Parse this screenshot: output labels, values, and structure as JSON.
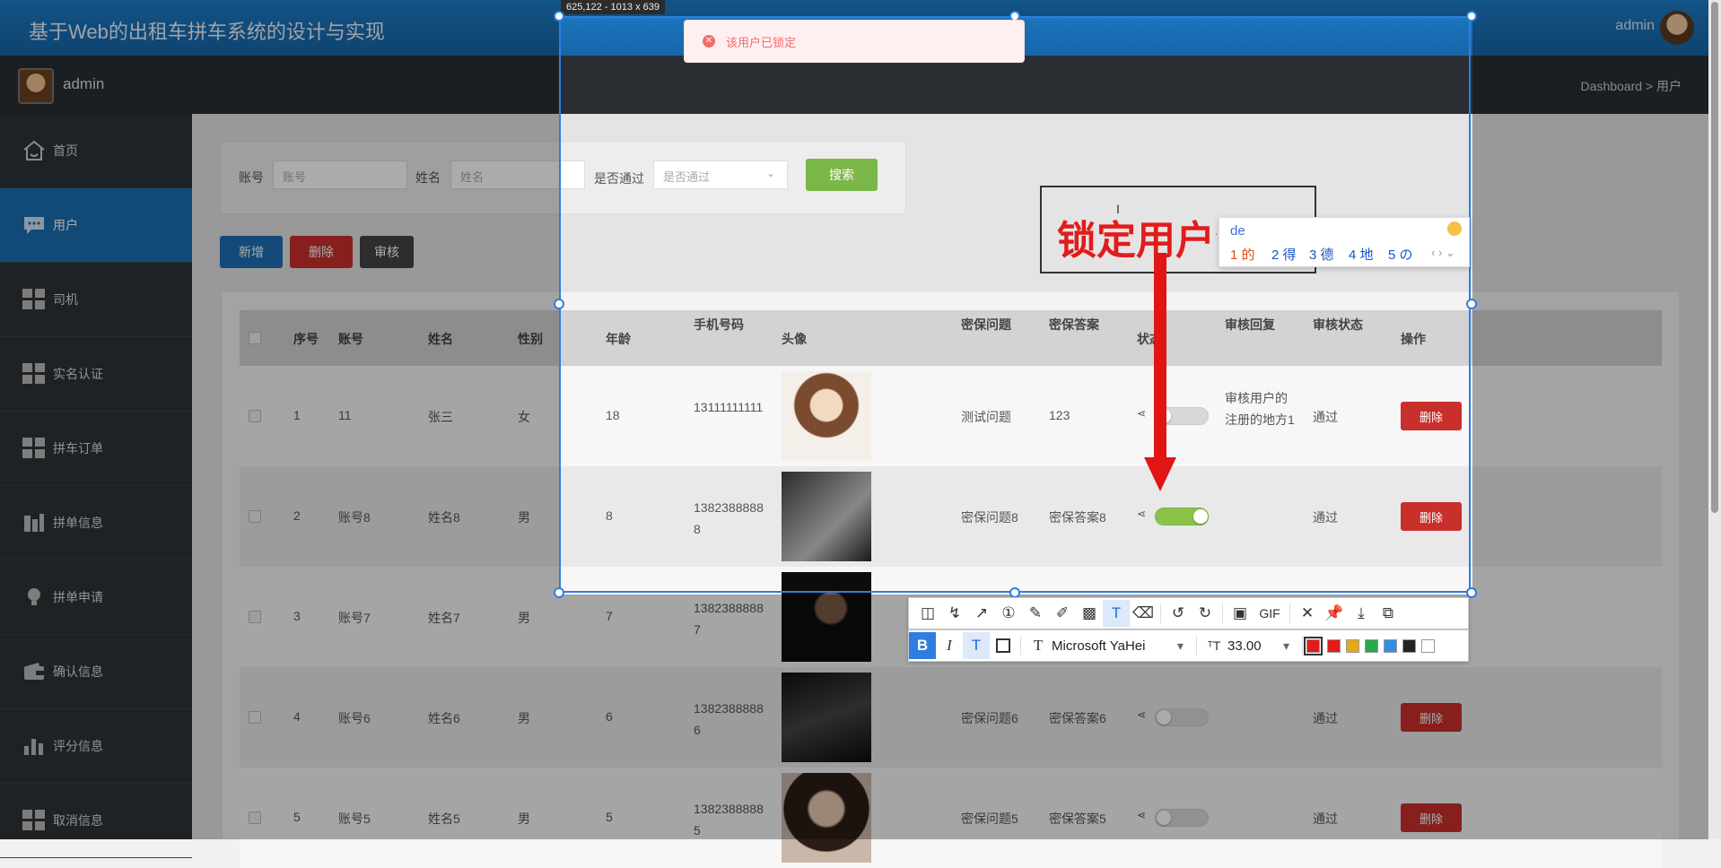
{
  "app": {
    "title": "基于Web的出租车拼车系统的设计与实现",
    "user": "admin"
  },
  "subbar": {
    "user": "admin",
    "breadcrumb": "Dashboard > 用户"
  },
  "sidebar": {
    "items": [
      {
        "label": "首页",
        "icon": "home-icon"
      },
      {
        "label": "用户",
        "icon": "chat-icon",
        "active": true
      },
      {
        "label": "司机",
        "icon": "grid-icon"
      },
      {
        "label": "实名认证",
        "icon": "grid-icon"
      },
      {
        "label": "拼车订单",
        "icon": "grid-icon"
      },
      {
        "label": "拼单信息",
        "icon": "building-icon"
      },
      {
        "label": "拼单申请",
        "icon": "bulb-icon"
      },
      {
        "label": "确认信息",
        "icon": "wallet-icon"
      },
      {
        "label": "评分信息",
        "icon": "bar-chart-icon"
      },
      {
        "label": "取消信息",
        "icon": "grid-icon"
      }
    ]
  },
  "search": {
    "account_label": "账号",
    "account_placeholder": "账号",
    "name_label": "姓名",
    "name_placeholder": "姓名",
    "passed_label": "是否通过",
    "passed_placeholder": "是否通过",
    "search_button": "搜索"
  },
  "actions": {
    "add": "新增",
    "delete": "删除",
    "review": "审核"
  },
  "table": {
    "headers": [
      "序号",
      "账号",
      "姓名",
      "性别",
      "年龄",
      "手机号码",
      "头像",
      "密保问题",
      "密保答案",
      "状态",
      "审核回复",
      "审核状态",
      "操作"
    ],
    "rows": [
      {
        "no": "1",
        "account": "11",
        "name": "张三",
        "gender": "女",
        "age": "18",
        "phone": "13111111111",
        "question": "测试问题",
        "answer": "123",
        "status_on": false,
        "reply": "审核用户的注册的地方1",
        "review": "通过",
        "op": "删除"
      },
      {
        "no": "2",
        "account": "账号8",
        "name": "姓名8",
        "gender": "男",
        "age": "8",
        "phone": "13823888888",
        "question": "密保问题8",
        "answer": "密保答案8",
        "status_on": true,
        "reply": "",
        "review": "通过",
        "op": "删除"
      },
      {
        "no": "3",
        "account": "账号7",
        "name": "姓名7",
        "gender": "男",
        "age": "7",
        "phone": "13823888887",
        "question": "",
        "answer": "",
        "status_on": false,
        "reply": "",
        "review": "",
        "op": "删除"
      },
      {
        "no": "4",
        "account": "账号6",
        "name": "姓名6",
        "gender": "男",
        "age": "6",
        "phone": "13823888886",
        "question": "密保问题6",
        "answer": "密保答案6",
        "status_on": false,
        "reply": "",
        "review": "通过",
        "op": "删除"
      },
      {
        "no": "5",
        "account": "账号5",
        "name": "姓名5",
        "gender": "男",
        "age": "5",
        "phone": "13823888885",
        "question": "密保问题5",
        "answer": "密保答案5",
        "status_on": false,
        "reply": "",
        "review": "通过",
        "op": "删除"
      }
    ]
  },
  "overlay": {
    "size_badge": "625,122 - 1013 x 639",
    "toast": "该用户已锁定",
    "annotation_text": "锁定用户注册",
    "ime": {
      "typed": "de",
      "candidates": [
        "1 的",
        "2 得",
        "3 德",
        "4 地",
        "5 の"
      ]
    },
    "font_name": "Microsoft YaHei",
    "font_size": "33.00",
    "gif_label": "GIF",
    "colors": [
      "#e31b1b",
      "#e31b1b",
      "#e6a817",
      "#2aa84a",
      "#2f8fe0",
      "#222222",
      "#ffffff"
    ]
  }
}
